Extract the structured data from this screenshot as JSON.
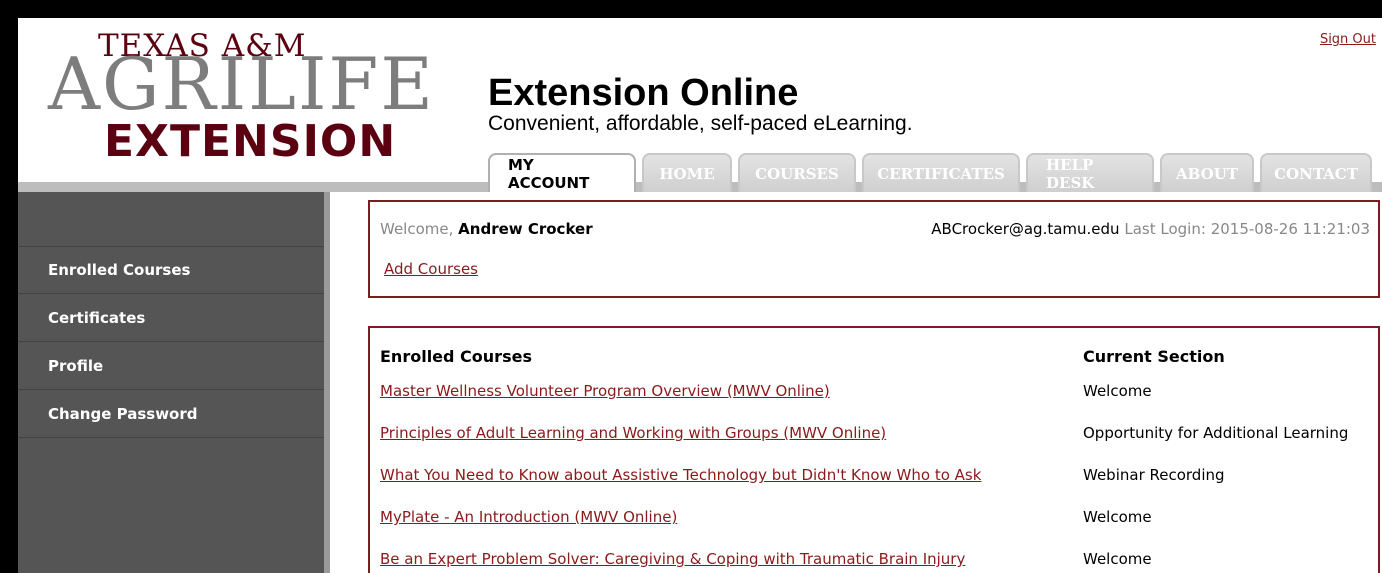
{
  "header": {
    "logo_line1": "TEXAS A&M",
    "logo_line2": "AGRILIFE",
    "logo_line3": "EXTENSION",
    "title": "Extension Online",
    "subtitle": "Convenient, affordable, self-paced eLearning.",
    "sign_out": "Sign Out"
  },
  "tabs": [
    "MY ACCOUNT",
    "HOME",
    "COURSES",
    "CERTIFICATES",
    "HELP DESK",
    "ABOUT",
    "CONTACT"
  ],
  "sidebar": {
    "items": [
      "Enrolled Courses",
      "Certificates",
      "Profile",
      "Change Password"
    ]
  },
  "welcome": {
    "prefix": "Welcome,",
    "name": "Andrew Crocker",
    "email": "ABCrocker@ag.tamu.edu",
    "last_login_label": "Last Login:",
    "last_login_value": "2015-08-26 11:21:03",
    "add_courses": "Add Courses"
  },
  "courses": {
    "header_course": "Enrolled Courses",
    "header_section": "Current Section",
    "rows": [
      {
        "course": "Master Wellness Volunteer Program Overview (MWV Online)",
        "section": "Welcome"
      },
      {
        "course": "Principles of Adult Learning and Working with Groups (MWV Online)",
        "section": "Opportunity for Additional Learning"
      },
      {
        "course": "What You Need to Know about Assistive Technology but Didn't Know Who to Ask",
        "section": "Webinar Recording"
      },
      {
        "course": "MyPlate - An Introduction (MWV Online)",
        "section": "Welcome"
      },
      {
        "course": "Be an Expert Problem Solver: Caregiving & Coping with Traumatic Brain Injury",
        "section": "Welcome"
      }
    ]
  },
  "colors": {
    "maroon": "#7d1b22",
    "sidebar": "#555555",
    "tab_inactive": "#d6d6d6"
  }
}
